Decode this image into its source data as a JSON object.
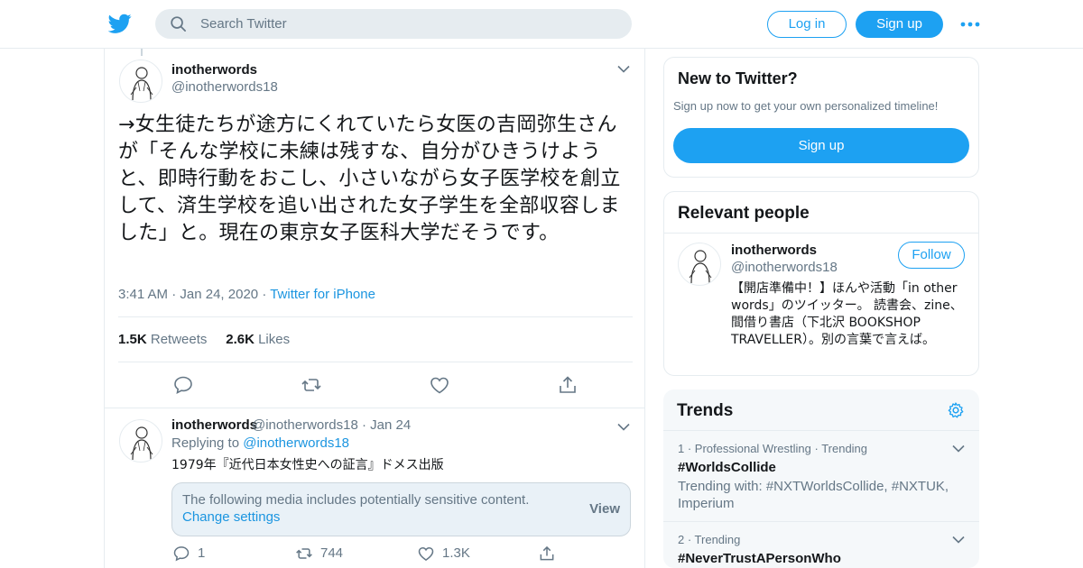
{
  "header": {
    "search_placeholder": "Search Twitter",
    "login_label": "Log in",
    "signup_label": "Sign up",
    "brand_color": "#1da1f2"
  },
  "tweet": {
    "name": "inotherwords",
    "handle": "@inotherwords18",
    "text": "→女生徒たちが途方にくれていたら女医の吉岡弥生さんが「そんな学校に未練は残すな、自分がひきうけようと、即時行動をおこし、小さいながら女子医学校を創立して、済生学校を追い出された女子学生を全部収容しました」と。現在の東京女子医科大学だそうです。",
    "time": "3:41 AM",
    "date": "Jan 24, 2020",
    "source": "Twitter for iPhone",
    "retweets_count": "1.5K",
    "retweets_label": "Retweets",
    "likes_count": "2.6K",
    "likes_label": "Likes"
  },
  "reply": {
    "name": "inotherwords",
    "handle": "@inotherwords18",
    "date": "Jan 24",
    "replying_prefix": "Replying to",
    "replying_to": "@inotherwords18",
    "text": "1979年『近代日本女性史への証言』ドメス出版",
    "sensitive_message": "The following media includes potentially sensitive content.",
    "change_settings": "Change settings",
    "view_label": "View",
    "reply_count": "1",
    "retweet_count": "744",
    "like_count": "1.3K"
  },
  "sidebar": {
    "new_title": "New to Twitter?",
    "new_subtitle": "Sign up now to get your own personalized timeline!",
    "new_signup": "Sign up",
    "relevant_title": "Relevant people",
    "person_name": "inotherwords",
    "person_handle": "@inotherwords18",
    "follow_label": "Follow",
    "person_bio": "【開店準備中！】ほんや活動「in other words」のツイッター。 読書会、zine、間借り書店（下北沢 BOOKSHOP TRAVELLER）。別の言葉で言えば。",
    "trends_title": "Trends",
    "trends": [
      {
        "meta": "1 · Professional Wrestling · Trending",
        "name": "#WorldsCollide",
        "sub": "Trending with: #NXTWorldsCollide, #NXTUK, Imperium"
      },
      {
        "meta": "2 · Trending",
        "name": "#NeverTrustAPersonWho",
        "sub": ""
      }
    ]
  }
}
